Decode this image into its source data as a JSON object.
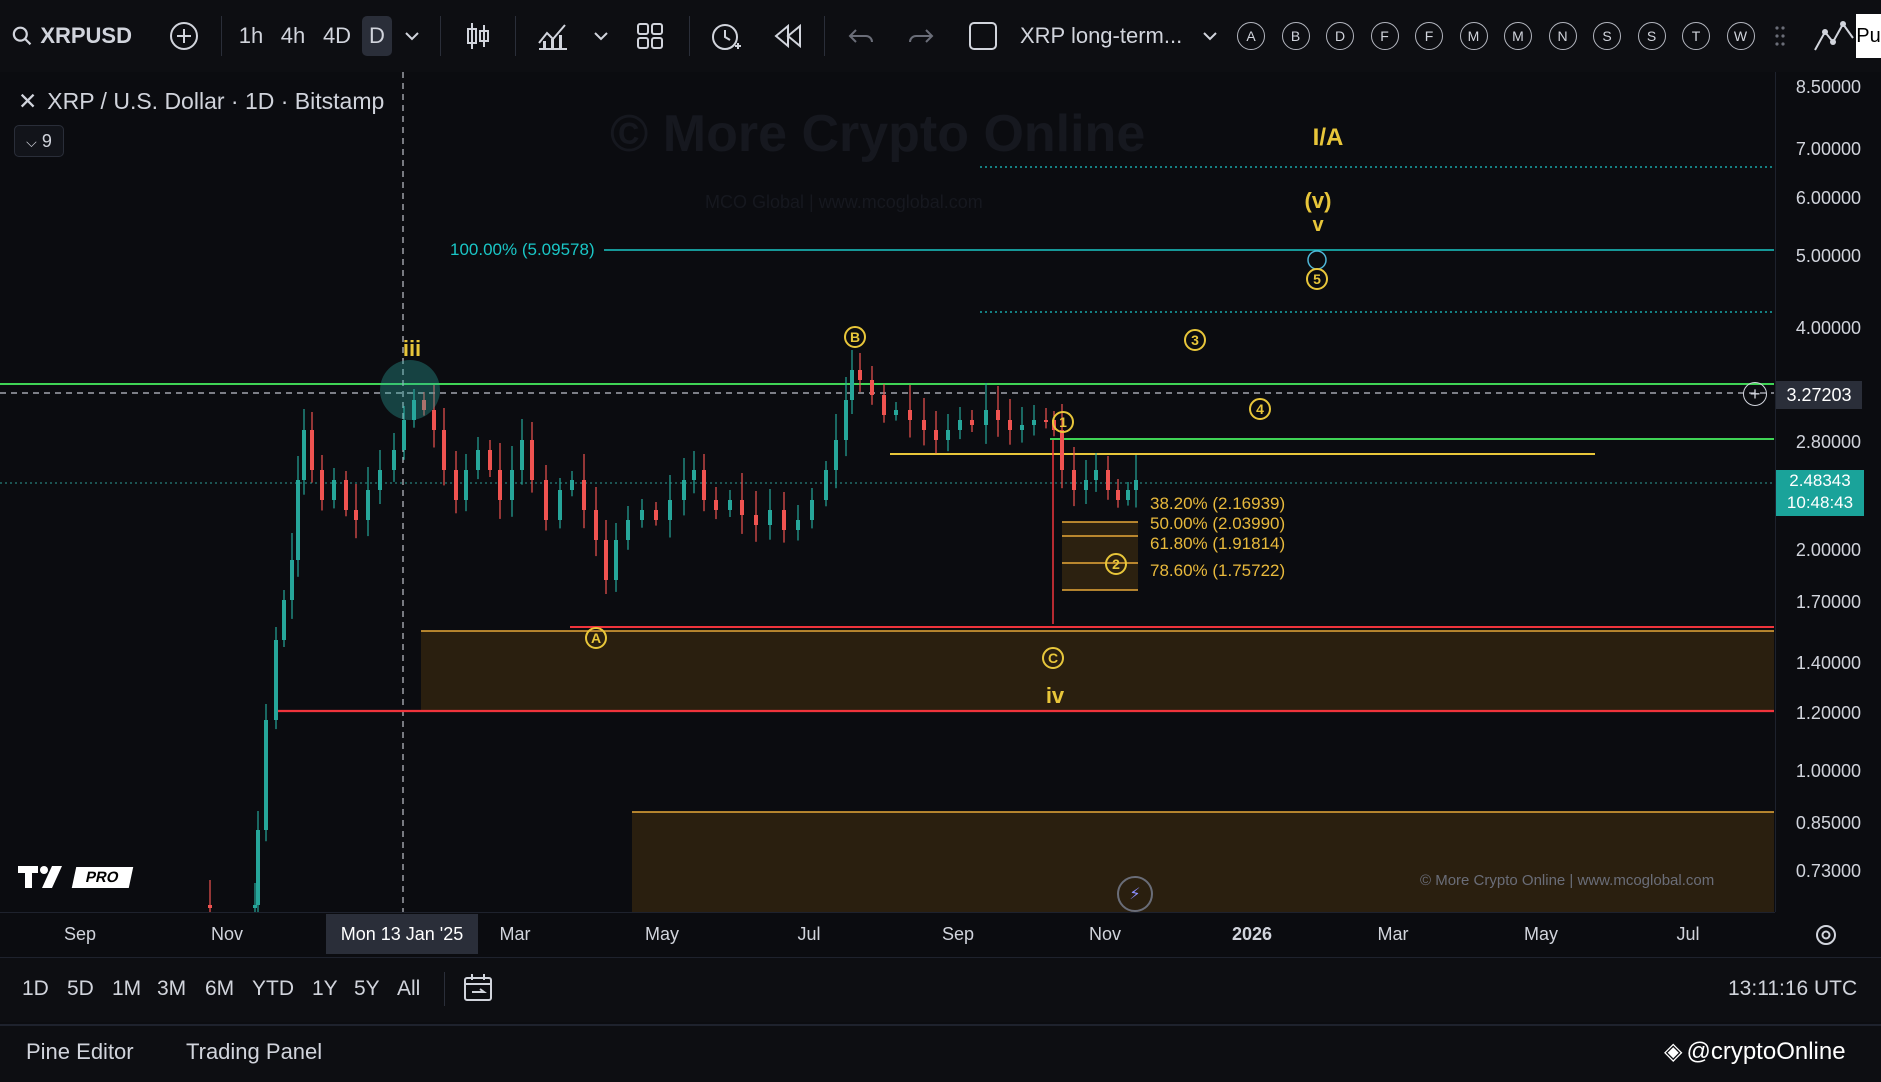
{
  "toolbar": {
    "symbol": "XRPUSD",
    "timeframes": [
      "1h",
      "4h",
      "4D",
      "D"
    ],
    "layout_name": "XRP long-term...",
    "letter_buttons": [
      "A",
      "B",
      "D",
      "F",
      "F",
      "M",
      "M",
      "N",
      "S",
      "S",
      "T",
      "W"
    ],
    "cut_label": "Pu"
  },
  "legend": {
    "title": "XRP / U.S. Dollar · 1D · Bitstamp",
    "indicator_count": "9"
  },
  "watermark": {
    "main": "© More Crypto Online",
    "sub": "MCO Global  |  www.mcoglobal.com",
    "corner": "© More Crypto Online  |  www.mcoglobal.com"
  },
  "price_axis": {
    "labels": [
      "8.50000",
      "7.00000",
      "6.00000",
      "5.00000",
      "4.00000",
      "3.27203",
      "2.80000",
      "2.00000",
      "1.70000",
      "1.40000",
      "1.20000",
      "1.00000",
      "0.85000",
      "0.73000"
    ],
    "current_price": "2.48343",
    "countdown": "10:48:43",
    "current_color": "#1aa39a",
    "crosshair_price": "3.27203"
  },
  "time_axis": {
    "labels": [
      "Sep",
      "Nov",
      "Mar",
      "May",
      "Jul",
      "Sep",
      "Nov",
      "2026",
      "Mar",
      "May",
      "Jul"
    ],
    "crosshair_date": "Mon 13 Jan '25"
  },
  "fib_levels": [
    {
      "label": "100.00% (5.09578)"
    },
    {
      "label": "38.20% (2.16939)"
    },
    {
      "label": "50.00% (2.03990)"
    },
    {
      "label": "61.80% (1.91814)"
    },
    {
      "label": "78.60% (1.75722)"
    }
  ],
  "wave_labels": {
    "ia": "I/A",
    "v_paren": "(v)",
    "v": "v",
    "iii": "iii",
    "iv": "iv",
    "circled": [
      "A",
      "B",
      "C",
      "1",
      "2",
      "3",
      "4",
      "5"
    ]
  },
  "range_bar": {
    "ranges": [
      "1D",
      "5D",
      "1M",
      "3M",
      "6M",
      "YTD",
      "1Y",
      "5Y",
      "All"
    ],
    "clock": "13:11:16 UTC"
  },
  "bottom_panel": {
    "tabs": [
      "Pine Editor",
      "Trading Panel"
    ],
    "handle": "@cryptoOnline"
  },
  "logo": {
    "text": "PRO"
  },
  "colors": {
    "green_line": "#3fd455",
    "red_line": "#f0343c",
    "cyan_line": "#1ac6c6",
    "wave_yellow": "#e8c63a",
    "support_box": "#3a2a10"
  }
}
